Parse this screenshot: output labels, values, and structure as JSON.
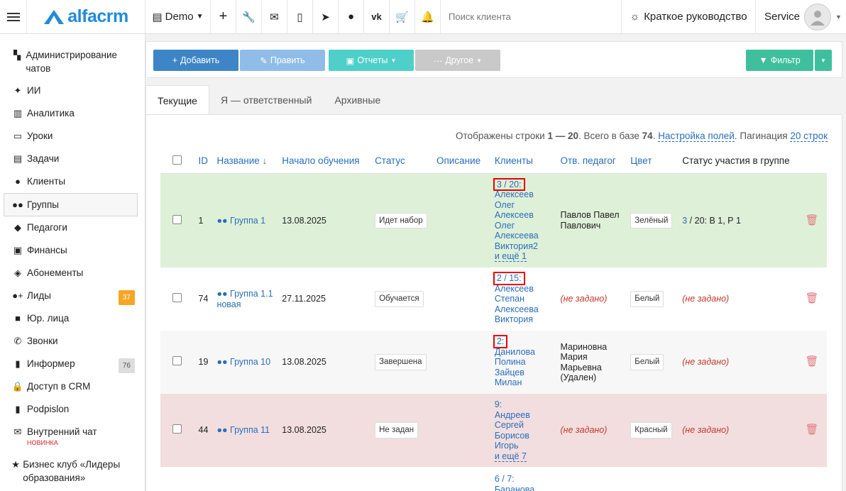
{
  "topbar": {
    "logo": "alfacrm",
    "demo_label": "Demo",
    "search_placeholder": "Поиск клиента",
    "guide_label": "Краткое руководство",
    "user_label": "Service"
  },
  "sidebar": {
    "items": [
      {
        "label": "Администрирование чатов",
        "icon": "chat-admin-icon"
      },
      {
        "label": "ИИ",
        "icon": "sparkle-icon"
      },
      {
        "label": "Аналитика",
        "icon": "map-icon"
      },
      {
        "label": "Уроки",
        "icon": "calendar-icon"
      },
      {
        "label": "Задачи",
        "icon": "clipboard-icon"
      },
      {
        "label": "Клиенты",
        "icon": "user-icon"
      },
      {
        "label": "Группы",
        "icon": "users-icon"
      },
      {
        "label": "Педагоги",
        "icon": "graduation-cap-icon"
      },
      {
        "label": "Финансы",
        "icon": "money-icon"
      },
      {
        "label": "Абонементы",
        "icon": "tag-icon"
      },
      {
        "label": "Лиды",
        "icon": "user-plus-icon",
        "badge": "37"
      },
      {
        "label": "Юр. лица",
        "icon": "briefcase-icon"
      },
      {
        "label": "Звонки",
        "icon": "phone-icon"
      },
      {
        "label": "Информер",
        "icon": "book-icon",
        "badge": "76"
      },
      {
        "label": "Доступ в CRM",
        "icon": "lock-icon"
      },
      {
        "label": "Podpislon",
        "icon": "document-icon"
      },
      {
        "label": "Внутренний чат",
        "icon": "envelope-icon",
        "tag": "НОВИНКА"
      },
      {
        "label": "Бизнес клуб «Лидеры образования»",
        "icon": "star-icon"
      }
    ]
  },
  "toolbar": {
    "add": "Добавить",
    "edit": "Править",
    "reports": "Отчеты",
    "other": "Другое",
    "filter": "Фильтр"
  },
  "tabs": [
    "Текущие",
    "Я — ответственный",
    "Архивные"
  ],
  "summary": {
    "prefix": "Отображены строки",
    "range": "1 — 20",
    "total_text": ". Всего в базе",
    "total": "74",
    "fields_link": "Настройка полей",
    "pagination_label": ". Пагинация",
    "pagination_link": "20 строк"
  },
  "table": {
    "headers": [
      "ID",
      "Название",
      "Начало обучения",
      "Статус",
      "Описание",
      "Клиенты",
      "Отв. педагог",
      "Цвет",
      "Статус участия в группе"
    ],
    "sort_arrow": "↓",
    "rows": [
      {
        "id": "1",
        "name": "Группа 1",
        "start": "13.08.2025",
        "status": "Идет набор",
        "counts": "3 / 20:",
        "clients": [
          "Алексеев",
          "Олег",
          "Алексеев",
          "Олег",
          "Алексеева",
          "Виктория2"
        ],
        "more": "и ещё 1",
        "teacher": "Павлов Павел Павлович",
        "color": "Зелёный",
        "participation_count": "3",
        "participation_rest": " / 20:  В 1, Р 1"
      },
      {
        "id": "74",
        "name": "Группа 1.1 новая",
        "start": "27.11.2025",
        "status": "Обучается",
        "counts": "2 / 15:",
        "clients": [
          "Алексеев",
          "Степан",
          "Алексеева",
          "Виктория"
        ],
        "more": "",
        "teacher": "(не задано)",
        "color": "Белый",
        "participation_count": "",
        "participation_rest": "(не задано)"
      },
      {
        "id": "19",
        "name": "Группа 10",
        "start": "13.08.2025",
        "status": "Завершена",
        "counts": "2:",
        "clients": [
          "Данилова",
          "Полина",
          "Зайцев",
          "Милан"
        ],
        "more": "",
        "teacher": "Мариновна Мария Марьевна (Удален)",
        "color": "Белый",
        "participation_count": "",
        "participation_rest": "(не задано)"
      },
      {
        "id": "44",
        "name": "Группа 11",
        "start": "13.08.2025",
        "status": "Не задан",
        "counts": "9:",
        "clients": [
          "Андреев",
          "Сергей",
          "Борисов",
          "Игорь"
        ],
        "more": "и ещё 7",
        "teacher": "(не задано)",
        "color": "Красный",
        "participation_count": "",
        "participation_rest": "(не задано)"
      },
      {
        "id": "",
        "name": "",
        "start": "",
        "status": "",
        "counts": "6 / 7:",
        "clients": [
          "Баранова"
        ],
        "more": "",
        "teacher": "",
        "color": "",
        "participation_count": "",
        "participation_rest": ""
      }
    ]
  }
}
